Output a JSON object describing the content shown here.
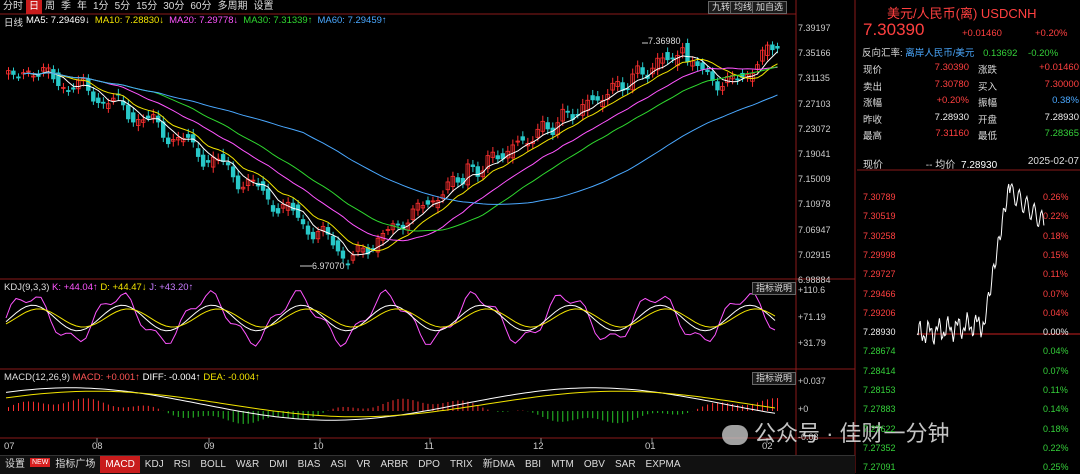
{
  "toolbar": {
    "periods": [
      "分时",
      "日",
      "周",
      "季",
      "年",
      "1分",
      "5分",
      "15分",
      "30分",
      "60分",
      "多周期",
      "设置"
    ],
    "selected": "日",
    "right_buttons": [
      "九转",
      "均线",
      "加自选"
    ]
  },
  "ma_line": [
    {
      "label": "MA5: 7.29469↓",
      "color": "#ffffff"
    },
    {
      "label": "MA10: 7.28830↓",
      "color": "#f2e400"
    },
    {
      "label": "MA20: 7.29778↓",
      "color": "#ff55ff"
    },
    {
      "label": "MA30: 7.31339↑",
      "color": "#2fd82f"
    },
    {
      "label": "MA60: 7.29459↑",
      "color": "#4aa8ff"
    }
  ],
  "main_label": "日线",
  "main_axis": [
    "7.39197",
    "7.35166",
    "7.31135",
    "7.27103",
    "7.23072",
    "7.19041",
    "7.15009",
    "7.10978",
    "7.06947",
    "7.02915",
    "6.98884"
  ],
  "high_marker": "7.36980",
  "low_marker": "6.97070",
  "kdj": {
    "title": "KDJ(9,3,3)",
    "k": "K: +44.04↑",
    "d": "D: +44.47↓",
    "j": "J: +43.20↑",
    "button": "指标说明",
    "axis": [
      "+110.6",
      "+71.19",
      "+31.79"
    ]
  },
  "macd": {
    "title": "MACD(12,26,9)",
    "macd": "MACD: +0.001↑",
    "diff": "DIFF: -0.004↑",
    "dea": "DEA: -0.004↑",
    "button": "指标说明",
    "axis": [
      "+0.037",
      "+0",
      "-0.03"
    ]
  },
  "months": [
    "07",
    "08",
    "09",
    "10",
    "11",
    "12",
    "01",
    "02"
  ],
  "bottom_tabs": [
    "设置",
    "NEW",
    "指标广场",
    "MACD",
    "KDJ",
    "RSI",
    "BOLL",
    "W&R",
    "DMI",
    "BIAS",
    "ASI",
    "VR",
    "ARBR",
    "DPO",
    "TRIX",
    "新DMA",
    "BBI",
    "MTM",
    "OBV",
    "SAR",
    "EXPMA"
  ],
  "bottom_selected": "MACD",
  "watermark": "公众号 · 佳财一分钟",
  "panel": {
    "name": "美元/人民币(离) USDCNH",
    "price": "7.30390",
    "change": "+0.01460",
    "pct": "+0.20%",
    "cross_label": "反向汇率:",
    "cross_link": "离岸人民币/美元",
    "cross_value": "0.13692",
    "cross_pct": "-0.20%",
    "rows": [
      [
        "现价",
        "7.30390",
        "涨跌",
        "+0.01460"
      ],
      [
        "卖出",
        "7.30780",
        "买入",
        "7.30000"
      ],
      [
        "涨幅",
        "+0.20%",
        "振幅",
        "0.38%"
      ],
      [
        "昨收",
        "7.28930",
        "开盘",
        "7.28930"
      ],
      [
        "最高",
        "7.31160",
        "最低",
        "7.28365"
      ]
    ],
    "intraday_header": {
      "label": "现价",
      "avg": "-- 均价",
      "avg_value": "7.28930",
      "date": "2025-02-07"
    },
    "left_axis": [
      "7.30789",
      "7.30519",
      "7.30258",
      "7.29998",
      "7.29727",
      "7.29466",
      "7.29206",
      "7.28930",
      "7.28674",
      "7.28414",
      "7.28153",
      "7.27883",
      "7.27622",
      "7.27352",
      "7.27091"
    ],
    "right_axis": [
      "0.26%",
      "0.22%",
      "0.18%",
      "0.15%",
      "0.11%",
      "0.07%",
      "0.04%",
      "0.00%",
      "0.04%",
      "0.07%",
      "0.11%",
      "0.14%",
      "0.18%",
      "0.22%",
      "0.25%"
    ]
  }
}
